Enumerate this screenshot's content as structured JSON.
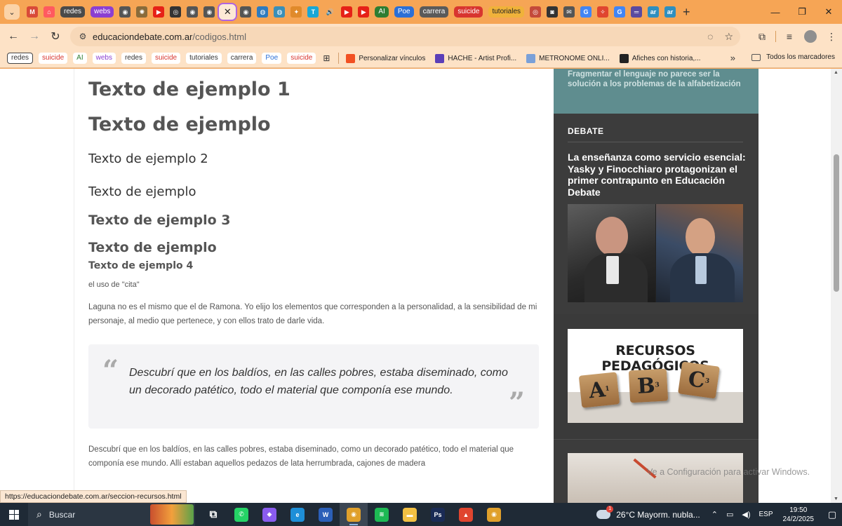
{
  "browser": {
    "tabs": [
      {
        "kind": "icon",
        "name": "gmail",
        "glyph": "M",
        "color": "#d94a38"
      },
      {
        "kind": "icon",
        "name": "airbnb",
        "glyph": "⌂",
        "color": "#ff5a5f"
      },
      {
        "kind": "pill",
        "name": "redes",
        "label": "redes",
        "color": "#4a4a4a"
      },
      {
        "kind": "pill",
        "name": "webs",
        "label": "webs",
        "color": "#8b3fd1"
      },
      {
        "kind": "icon",
        "name": "site",
        "glyph": "◉",
        "color": "#555555"
      },
      {
        "kind": "icon",
        "name": "site",
        "glyph": "✺",
        "color": "#8a6b3a"
      },
      {
        "kind": "icon",
        "name": "youtube",
        "glyph": "▶",
        "color": "#e62117"
      },
      {
        "kind": "icon",
        "name": "site",
        "glyph": "◎",
        "color": "#333333"
      },
      {
        "kind": "icon",
        "name": "site",
        "glyph": "◉",
        "color": "#555555"
      },
      {
        "kind": "icon",
        "name": "site",
        "glyph": "◉",
        "color": "#555555"
      },
      {
        "kind": "active",
        "name": "codigos"
      },
      {
        "kind": "icon",
        "name": "site",
        "glyph": "◉",
        "color": "#555555"
      },
      {
        "kind": "icon",
        "name": "site",
        "glyph": "◍",
        "color": "#2f7bbf"
      },
      {
        "kind": "icon",
        "name": "site",
        "glyph": "◍",
        "color": "#3a8fb8"
      },
      {
        "kind": "icon",
        "name": "site",
        "glyph": "✦",
        "color": "#e08a2b"
      },
      {
        "kind": "icon",
        "name": "site",
        "glyph": "T",
        "color": "#19a7d6"
      },
      {
        "kind": "icon",
        "name": "audio",
        "glyph": "🔊",
        "color": "#00000000"
      },
      {
        "kind": "icon",
        "name": "youtube",
        "glyph": "▶",
        "color": "#e62117"
      },
      {
        "kind": "icon",
        "name": "youtube",
        "glyph": "▶",
        "color": "#e62117"
      },
      {
        "kind": "pill",
        "name": "ai",
        "label": "AI",
        "color": "#2f7d32"
      },
      {
        "kind": "pill",
        "name": "poe",
        "label": "Poe",
        "color": "#2b6fd6"
      },
      {
        "kind": "pill",
        "name": "carrera",
        "label": "carrera",
        "color": "#5a5a5a"
      },
      {
        "kind": "pill",
        "name": "suicide",
        "label": "suicide",
        "color": "#d8352f"
      },
      {
        "kind": "pill",
        "name": "tutoriales",
        "label": "tutoriales",
        "color": "#f0b23a"
      },
      {
        "kind": "icon",
        "name": "site",
        "glyph": "◎",
        "color": "#c44a3a"
      },
      {
        "kind": "icon",
        "name": "site",
        "glyph": "◙",
        "color": "#333333"
      },
      {
        "kind": "icon",
        "name": "mail",
        "glyph": "✉",
        "color": "#555555"
      },
      {
        "kind": "icon",
        "name": "google",
        "glyph": "G",
        "color": "#4285f4"
      },
      {
        "kind": "icon",
        "name": "site",
        "glyph": "✧",
        "color": "#e0452f"
      },
      {
        "kind": "icon",
        "name": "google",
        "glyph": "G",
        "color": "#4285f4"
      },
      {
        "kind": "icon",
        "name": "site",
        "glyph": "═",
        "color": "#5a4aa0"
      },
      {
        "kind": "icon",
        "name": "site",
        "glyph": "ar",
        "color": "#2f8fbf"
      },
      {
        "kind": "icon",
        "name": "site",
        "glyph": "ar",
        "color": "#2f8fbf"
      }
    ],
    "url_host": "educaciondebate.com.ar",
    "url_path": "/codigos.html",
    "bookmarks_pills": [
      {
        "label": "redes",
        "color": "#333333",
        "outlined": true
      },
      {
        "label": "suicide",
        "color": "#d8352f",
        "outlined": false
      },
      {
        "label": "AI",
        "color": "#2f7d32",
        "outlined": false
      },
      {
        "label": "webs",
        "color": "#8b3fd1",
        "outlined": false
      },
      {
        "label": "redes",
        "color": "#333333",
        "outlined": false
      },
      {
        "label": "suicide",
        "color": "#d8352f",
        "outlined": false
      },
      {
        "label": "tutoriales",
        "color": "#333333",
        "outlined": false
      },
      {
        "label": "carrera",
        "color": "#333333",
        "outlined": false
      },
      {
        "label": "Poe",
        "color": "#2b6fd6",
        "outlined": false
      },
      {
        "label": "suicide",
        "color": "#d8352f",
        "outlined": false
      }
    ],
    "bookmark_links": [
      {
        "label": "Personalizar vínculos",
        "icon": "microsoft-icon",
        "color": "#f25022"
      },
      {
        "label": "HACHE - Artist Profi...",
        "icon": "spotify-icon",
        "color": "#5b3fb8"
      },
      {
        "label": "METRONOME ONLI...",
        "icon": "metronome-icon",
        "color": "#7aa0d8"
      },
      {
        "label": "Afiches con historia,...",
        "icon": "globe-icon",
        "color": "#222222"
      }
    ],
    "all_bookmarks_label": "Todos los marcadores",
    "status_url": "https://educaciondebate.com.ar/seccion-recursos.html"
  },
  "page": {
    "headings": {
      "h1a": "Texto de ejemplo 1",
      "h1b": "Texto de ejemplo",
      "h2a": "Texto de ejemplo 2",
      "h2b": "Texto de ejemplo",
      "h3a": "Texto de ejemplo 3",
      "h3b": "Texto de ejemplo",
      "h4a": "Texto de ejemplo 4"
    },
    "cita_label": "el uso de \"cita\"",
    "paragraph1": "Laguna no es el mismo que el de Ramona. Yo elijo los elementos que corresponden a la personalidad, a la sensibilidad de mi personaje, al medio que pertenece, y con ellos trato de darle vida.",
    "quote": "Descubrí que en los baldíos, en las calles pobres, estaba diseminado, como un decorado patético, todo el material que componía ese mundo.",
    "paragraph2": "Descubrí que en los baldíos, en las calles pobres, estaba diseminado, como un decorado patético, todo el material que componía ese mundo. Allí estaban aquellos pedazos de lata herrumbrada, cajones de madera"
  },
  "sidebar": {
    "teal_text": "Fragmentar el lenguaje no parece ser la solución a los problemas de la alfabetización",
    "section_label": "DEBATE",
    "headline": "La enseñanza como servicio esencial: Yasky y Finocchiaro protagonizan el primer contrapunto en Educación Debate",
    "recursos_title": "RECURSOS PEDAGÓGICOS",
    "tiles": [
      {
        "letter": "A",
        "sub": "1"
      },
      {
        "letter": "B",
        "sub": "3"
      },
      {
        "letter": "C",
        "sub": "3"
      }
    ]
  },
  "watermark": "Ve a Configuración para activar Windows.",
  "taskbar": {
    "search_label": "Buscar",
    "apps": [
      {
        "name": "task-view",
        "glyph": "⧉",
        "color": "#00000000",
        "running": false
      },
      {
        "name": "whatsapp",
        "glyph": "✆",
        "color": "#25d366",
        "running": false
      },
      {
        "name": "copilot",
        "glyph": "◆",
        "color": "#8a5cf0",
        "running": false
      },
      {
        "name": "edge",
        "glyph": "e",
        "color": "#1e8fd8",
        "running": false
      },
      {
        "name": "word",
        "glyph": "W",
        "color": "#2b5fb8",
        "running": false
      },
      {
        "name": "chrome",
        "glyph": "◉",
        "color": "#e0a02b",
        "running": true
      },
      {
        "name": "spotify",
        "glyph": "≋",
        "color": "#1db954",
        "running": false
      },
      {
        "name": "file-explorer",
        "glyph": "▬",
        "color": "#f2c043",
        "running": false
      },
      {
        "name": "photoshop",
        "glyph": "Ps",
        "color": "#1a2b55",
        "running": false
      },
      {
        "name": "brave",
        "glyph": "▲",
        "color": "#e0452f",
        "running": false
      },
      {
        "name": "chrome",
        "glyph": "◉",
        "color": "#e0a02b",
        "running": false
      }
    ],
    "weather_badge": "1",
    "weather": "26°C  Mayorm. nubla...",
    "language": "ESP",
    "time": "19:50",
    "date": "24/2/2025"
  }
}
